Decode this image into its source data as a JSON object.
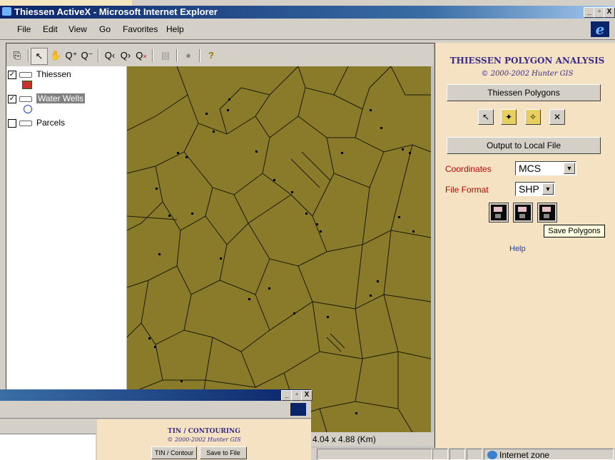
{
  "window": {
    "title": "Thiessen ActiveX - Microsoft Internet Explorer",
    "buttons": [
      "_",
      "▫",
      "X"
    ]
  },
  "menu": [
    "File",
    "Edit",
    "View",
    "Go",
    "Favorites",
    "Help"
  ],
  "toolbar": {
    "tools": [
      "copy-icon",
      "pointer-icon",
      "pan-icon",
      "zoom-in-icon",
      "zoom-out-icon",
      "zoom-previous-icon",
      "zoom-next-icon",
      "zoom-full-icon",
      "identify-icon",
      "stop-icon",
      "help-icon"
    ]
  },
  "layers": [
    {
      "name": "Thiessen",
      "checked": true,
      "selected": false
    },
    {
      "name": "Water Wells",
      "checked": true,
      "selected": true
    },
    {
      "name": "Parcels",
      "checked": false,
      "selected": false
    }
  ],
  "map": {
    "scale_text": "4.04 x 4.88 (Km)",
    "fill": "#8a7b2a"
  },
  "panel": {
    "title": "THIESSEN POLYGON ANALYSIS",
    "copyright": "© 2000-2002 Hunter GIS",
    "thiessen_button": "Thiessen Polygons",
    "output_button": "Output to Local File",
    "coordinates_label": "Coordinates",
    "coordinates_value": "MCS",
    "format_label": "File Format",
    "format_value": "SHP",
    "help_link": "Help",
    "tooltip": "Save Polygons"
  },
  "second_window": {
    "title": "TIN / CONTOURING",
    "copyright": "© 2000-2002 Hunter GIS",
    "tin_button": "TIN / Contour",
    "save_button": "Save to File",
    "buttons": [
      "_",
      "▫",
      "X"
    ]
  },
  "status": {
    "zone": "Internet zone"
  },
  "colors": {
    "accent_red": "#c00000",
    "panel_bg": "#f4e2c2",
    "titlebar": "#0a246a"
  }
}
